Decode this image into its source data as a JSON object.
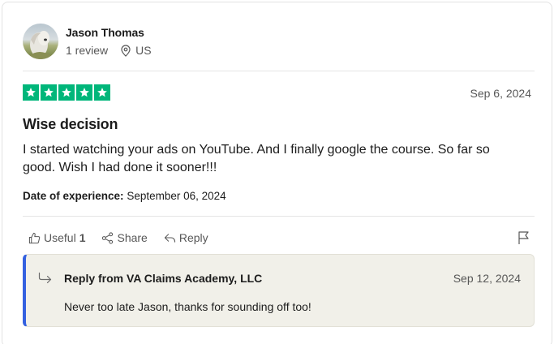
{
  "reviewer": {
    "name": "Jason Thomas",
    "review_count": "1 review",
    "country": "US"
  },
  "review": {
    "rating": 5,
    "rating_color": "#00b67a",
    "date": "Sep 6, 2024",
    "title": "Wise decision",
    "body": "I started watching your ads on YouTube. And I finally google the course. So far so good. Wish I had done it sooner!!!",
    "experience_label": "Date of experience:",
    "experience_date": "September 06, 2024"
  },
  "actions": {
    "useful_label": "Useful",
    "useful_count": "1",
    "share_label": "Share",
    "reply_label": "Reply",
    "flag_icon": "flag-icon"
  },
  "reply": {
    "title": "Reply from VA Claims Academy, LLC",
    "date": "Sep 12, 2024",
    "text": "Never too late Jason, thanks for sounding off too!",
    "accent_color": "#3461e0"
  }
}
